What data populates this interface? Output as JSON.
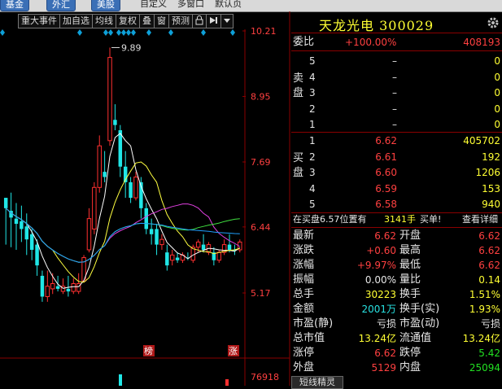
{
  "top_tabs": [
    "基金",
    "外汇",
    "美股"
  ],
  "top_menu": [
    "自定义",
    "多窗口",
    "默认页"
  ],
  "toolbar": {
    "items": [
      "重大事件",
      "加自选",
      "均线",
      "复权",
      "叠",
      "窗",
      "预测"
    ],
    "lock_icon": "lock-icon",
    "next_icon": "play-next-icon",
    "dropdown_icon": "chevron-down-icon"
  },
  "chart": {
    "price_axis": [
      "10.21",
      "8.95",
      "7.69",
      "6.44",
      "5.17"
    ],
    "volume_axis": "76918",
    "high_label": "9.89",
    "markers": [
      "榜",
      "涨"
    ],
    "candles": [
      [
        7.0,
        7.0,
        6.8,
        6.1,
        "down"
      ],
      [
        7.1,
        6.75,
        6.62,
        6.05,
        "down"
      ],
      [
        6.9,
        6.6,
        6.5,
        6.0,
        "down"
      ],
      [
        6.85,
        6.55,
        6.4,
        6.15,
        "down"
      ],
      [
        6.7,
        6.45,
        6.2,
        5.9,
        "down"
      ],
      [
        6.4,
        6.3,
        6.0,
        5.8,
        "down"
      ],
      [
        6.2,
        6.1,
        5.7,
        5.5,
        "down"
      ],
      [
        5.6,
        5.5,
        5.1,
        5.0,
        "down"
      ],
      [
        5.6,
        5.1,
        5.3,
        5.0,
        "up"
      ],
      [
        5.55,
        5.25,
        5.35,
        5.15,
        "up"
      ],
      [
        5.5,
        5.3,
        5.25,
        5.2,
        "down"
      ],
      [
        5.45,
        5.2,
        5.3,
        5.15,
        "up"
      ],
      [
        5.5,
        5.25,
        5.2,
        5.1,
        "down"
      ],
      [
        5.45,
        5.2,
        5.35,
        5.15,
        "up"
      ],
      [
        5.55,
        5.2,
        5.35,
        5.15,
        "up"
      ],
      [
        5.9,
        5.4,
        5.85,
        5.4,
        "up"
      ],
      [
        6.8,
        6.0,
        6.6,
        5.95,
        "up"
      ],
      [
        7.3,
        6.4,
        7.2,
        6.3,
        "up"
      ],
      [
        8.2,
        7.2,
        8.0,
        7.1,
        "up"
      ],
      [
        7.9,
        7.4,
        7.5,
        7.3,
        "down"
      ],
      [
        9.89,
        8.1,
        9.7,
        8.0,
        "up"
      ],
      [
        8.8,
        8.5,
        8.4,
        8.3,
        "down"
      ],
      [
        8.4,
        8.3,
        7.6,
        7.4,
        "down"
      ],
      [
        7.9,
        7.6,
        7.3,
        7.0,
        "down"
      ],
      [
        7.4,
        7.3,
        7.0,
        6.9,
        "down"
      ],
      [
        7.5,
        7.0,
        7.4,
        6.95,
        "up"
      ],
      [
        7.4,
        7.3,
        6.8,
        6.6,
        "down"
      ],
      [
        6.9,
        6.8,
        6.4,
        6.3,
        "down"
      ],
      [
        6.6,
        6.4,
        6.3,
        6.1,
        "down"
      ],
      [
        6.5,
        6.4,
        6.1,
        5.9,
        "down"
      ],
      [
        6.3,
        6.1,
        6.2,
        6.0,
        "up"
      ],
      [
        6.1,
        5.95,
        5.7,
        5.6,
        "down"
      ],
      [
        6.0,
        5.8,
        5.9,
        5.7,
        "up"
      ],
      [
        5.95,
        5.85,
        5.8,
        5.75,
        "down"
      ],
      [
        5.95,
        5.8,
        5.9,
        5.75,
        "up"
      ],
      [
        5.95,
        5.85,
        5.85,
        5.8,
        "down"
      ],
      [
        6.1,
        5.8,
        6.05,
        5.75,
        "up"
      ],
      [
        6.2,
        6.05,
        6.15,
        5.95,
        "up"
      ],
      [
        6.3,
        6.1,
        6.0,
        5.95,
        "down"
      ],
      [
        6.15,
        5.95,
        6.1,
        5.9,
        "up"
      ],
      [
        6.05,
        5.95,
        5.8,
        5.7,
        "down"
      ],
      [
        6.0,
        5.8,
        5.95,
        5.75,
        "up"
      ],
      [
        6.2,
        5.95,
        6.1,
        5.9,
        "up"
      ],
      [
        6.3,
        6.1,
        6.0,
        5.95,
        "down"
      ],
      [
        6.1,
        6.0,
        6.0,
        5.9,
        "down"
      ],
      [
        6.2,
        6.0,
        6.15,
        5.95,
        "up"
      ]
    ]
  },
  "quote": {
    "title": "天龙光电 300029",
    "gear_icon": "gear-icon",
    "weibi_label": "委比",
    "weibi_value": "+100.00%",
    "weibi_diff": "408193",
    "sell_label": "卖盘",
    "buy_label": "买盘",
    "sell": [
      {
        "level": "5",
        "price": "–",
        "vol": "0"
      },
      {
        "level": "4",
        "price": "–",
        "vol": "0"
      },
      {
        "level": "3",
        "price": "–",
        "vol": "0"
      },
      {
        "level": "2",
        "price": "–",
        "vol": "0"
      },
      {
        "level": "1",
        "price": "–",
        "vol": "0"
      }
    ],
    "buy": [
      {
        "level": "1",
        "price": "6.62",
        "vol": "405702"
      },
      {
        "level": "2",
        "price": "6.61",
        "vol": "192"
      },
      {
        "level": "3",
        "price": "6.60",
        "vol": "1206"
      },
      {
        "level": "4",
        "price": "6.59",
        "vol": "153"
      },
      {
        "level": "5",
        "price": "6.58",
        "vol": "940"
      }
    ],
    "bar_text": "在买盘6.57位置有",
    "bar_vol": "3141手",
    "bar_action": "买单!",
    "bar_detail": "查看详细",
    "stats": [
      [
        "最新",
        "6.62",
        "red",
        "开盘",
        "6.62",
        "red"
      ],
      [
        "涨跌",
        "+0.60",
        "red",
        "最高",
        "6.62",
        "red"
      ],
      [
        "涨幅",
        "+9.97%",
        "red",
        "最低",
        "6.62",
        "red"
      ],
      [
        "振幅",
        "0.00%",
        "white",
        "量比",
        "0.14",
        "yellow"
      ],
      [
        "总手",
        "30223",
        "yellow",
        "换手",
        "1.51%",
        "yellow"
      ],
      [
        "金额",
        "2001万",
        "cyan",
        "换手(实)",
        "1.93%",
        "yellow"
      ],
      [
        "市盈(静)",
        "亏损",
        "white",
        "市盈(动)",
        "亏损",
        "white"
      ],
      [
        "总市值",
        "13.24亿",
        "yellow",
        "流通值",
        "13.24亿",
        "yellow"
      ],
      [
        "涨停",
        "6.62",
        "red",
        "跌停",
        "5.42",
        "green"
      ],
      [
        "外盘",
        "5129",
        "red",
        "内盘",
        "25094",
        "green"
      ]
    ],
    "bottom_tab": "短线精灵"
  }
}
